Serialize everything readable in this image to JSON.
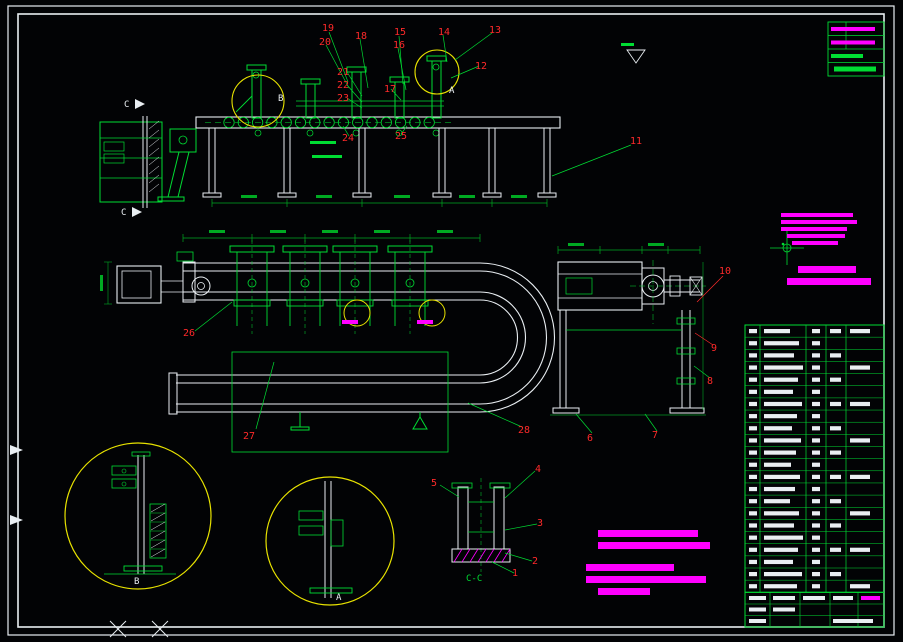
{
  "colors": {
    "background": "#020305",
    "line_white": "#e9eef2",
    "line_green": "#00dd33",
    "dim_green": "#00aa22",
    "callout_red": "#ff2a2a",
    "detail_yellow": "#e8e300",
    "note_magenta": "#ff00ff"
  },
  "callouts": {
    "c1": "1",
    "c2": "2",
    "c3": "3",
    "c4": "4",
    "c5": "5",
    "c6": "6",
    "c7": "7",
    "c8": "8",
    "c9": "9",
    "c10": "10",
    "c11": "11",
    "c12": "12",
    "c13": "13",
    "c14": "14",
    "c15": "15",
    "c16": "16",
    "c17": "17",
    "c18": "18",
    "c19": "19",
    "c20": "20",
    "c21": "21",
    "c22": "22",
    "c23": "23",
    "c24": "24",
    "c25": "25",
    "c26": "26",
    "c27": "27",
    "c28": "28"
  },
  "labels": {
    "b_top": "B",
    "a_top": "A",
    "c_top": "C",
    "c_bottom": "C",
    "b_bottom": "B",
    "a_bottom": "A",
    "section_cc": "C-C"
  }
}
